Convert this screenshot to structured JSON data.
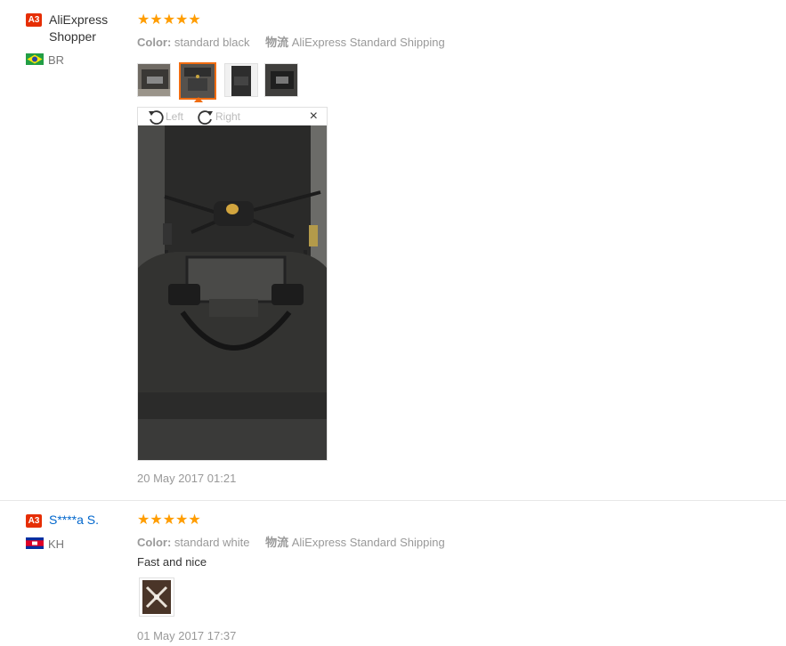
{
  "reviews": [
    {
      "level": "A3",
      "user": "AliExpress Shopper",
      "country": "BR",
      "rating": "★★★★★",
      "color_label": "Color:",
      "color_value": "standard black",
      "shipping_label": "物流",
      "shipping_value": "AliExpress Standard Shipping",
      "date": "20 May 2017 01:21",
      "viewer": {
        "rotate_left": "Left",
        "rotate_right": "Right",
        "close": "×"
      }
    },
    {
      "level": "A3",
      "user": "S****a S.",
      "country": "KH",
      "rating": "★★★★★",
      "color_label": "Color:",
      "color_value": "standard white",
      "shipping_label": "物流",
      "shipping_value": "AliExpress Standard Shipping",
      "comment": "Fast and nice",
      "date": "01 May 2017 17:37"
    }
  ],
  "colors": {
    "accent": "#f06c11",
    "star": "#ff9d00",
    "level_badge": "#e62e04",
    "link": "#06c"
  }
}
